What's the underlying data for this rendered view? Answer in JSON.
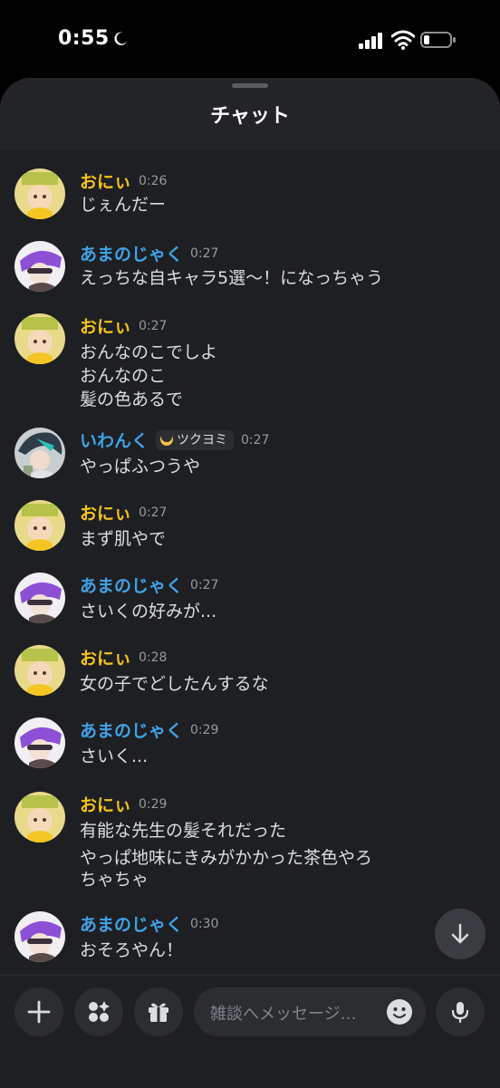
{
  "status_bar": {
    "time": "0:55"
  },
  "channel": {
    "title": "チャット"
  },
  "messages": [
    {
      "author": "おにぃ",
      "time": "0:26",
      "lines": [
        "じぇんだー"
      ]
    },
    {
      "author": "あまのじゃく",
      "time": "0:27",
      "lines": [
        "えっちな自キャラ5選〜！になっちゃう"
      ]
    },
    {
      "author": "おにぃ",
      "time": "0:27",
      "lines": [
        "おんなのこでしよ",
        "おんなのこ",
        "髪の色あるで"
      ]
    },
    {
      "author": "いわんく",
      "role": "ツクヨミ",
      "time": "0:27",
      "lines": [
        "やっぱふつうや"
      ]
    },
    {
      "author": "おにぃ",
      "time": "0:27",
      "lines": [
        "まず肌やで"
      ]
    },
    {
      "author": "あまのじゃく",
      "time": "0:27",
      "lines": [
        "さいくの好みが..."
      ]
    },
    {
      "author": "おにぃ",
      "time": "0:28",
      "lines": [
        "女の子でどしたんするな"
      ]
    },
    {
      "author": "あまのじゃく",
      "time": "0:29",
      "lines": [
        "さいく..."
      ]
    },
    {
      "author": "おにぃ",
      "time": "0:29",
      "lines": [
        "有能な先生の髪それだった",
        "やっぱ地味にきみがかかった茶色やろ",
        "ちゃちゃ"
      ]
    },
    {
      "author": "あまのじゃく",
      "time": "0:30",
      "lines": [
        "おそろやん！"
      ]
    }
  ],
  "composer": {
    "placeholder": "雑談へメッセージ…"
  },
  "colors": {
    "background": "#1e1f22",
    "author_oni": "#f5c518",
    "author_amanojaku": "#3fa3e6",
    "author_iwanku": "#3fa3e6",
    "text": "#dbdee1",
    "timestamp": "#949ba4"
  },
  "icons": {
    "status": [
      "moon-icon",
      "signal-icon",
      "wifi-icon",
      "battery-icon"
    ],
    "composer": [
      "plus-icon",
      "apps-icon",
      "gift-icon",
      "emoji-icon",
      "microphone-icon"
    ],
    "scroll": "arrow-down-icon"
  }
}
